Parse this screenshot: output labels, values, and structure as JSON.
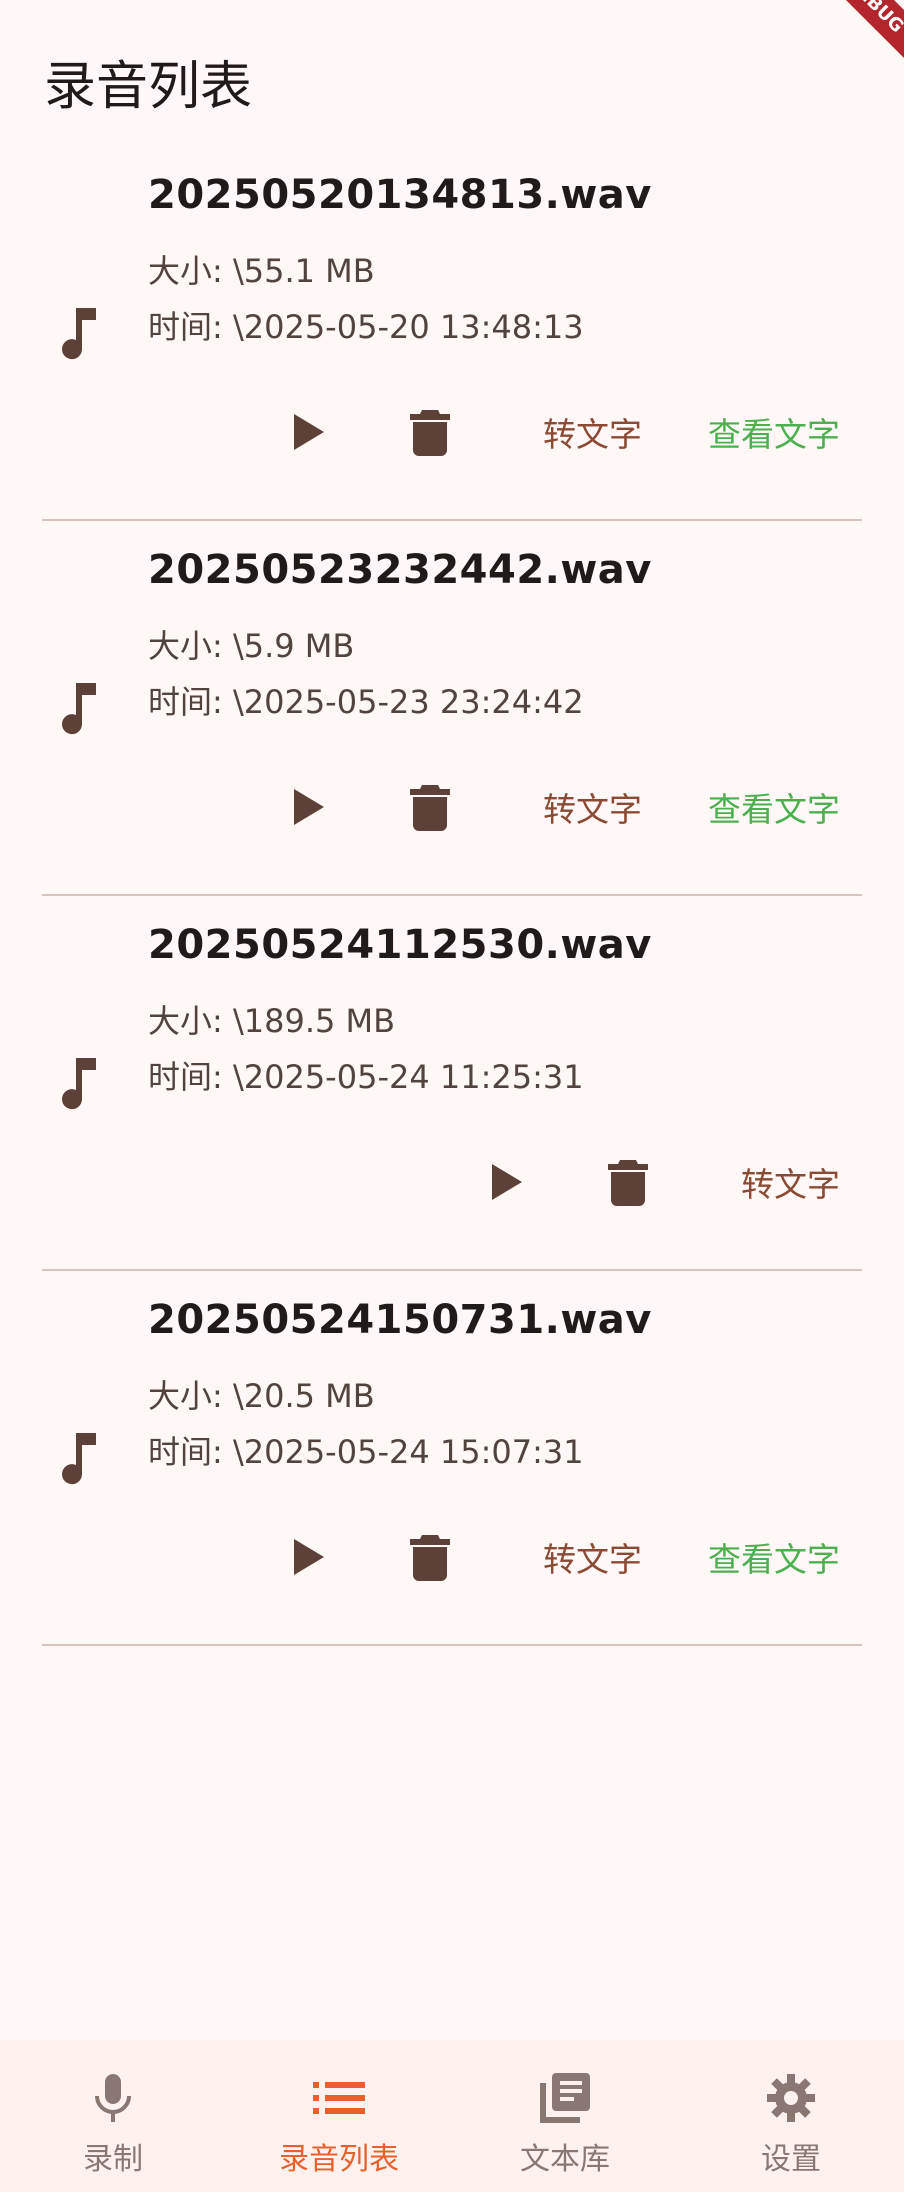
{
  "debug_banner": "DEBUG",
  "app_bar": {
    "title": "录音列表"
  },
  "recordings": [
    {
      "name": "20250520134813.wav",
      "size": "大小: \\55.1 MB",
      "time": "时间: \\2025-05-20 13:48:13",
      "has_text": true
    },
    {
      "name": "20250523232442.wav",
      "size": "大小: \\5.9 MB",
      "time": "时间: \\2025-05-23 23:24:42",
      "has_text": true
    },
    {
      "name": "20250524112530.wav",
      "size": "大小: \\189.5 MB",
      "time": "时间: \\2025-05-24 11:25:31",
      "has_text": false
    },
    {
      "name": "20250524150731.wav",
      "size": "大小: \\20.5 MB",
      "time": "时间: \\2025-05-24 15:07:31",
      "has_text": true
    }
  ],
  "actions": {
    "play_icon": "play-icon",
    "delete_icon": "trash-icon",
    "transcribe_label": "转文字",
    "view_text_label": "查看文字"
  },
  "bottom_nav": {
    "items": [
      {
        "label": "录制",
        "icon": "mic-icon",
        "active": false
      },
      {
        "label": "录音列表",
        "icon": "list-icon",
        "active": true
      },
      {
        "label": "文本库",
        "icon": "library-icon",
        "active": false
      },
      {
        "label": "设置",
        "icon": "gear-icon",
        "active": false
      }
    ]
  },
  "colors": {
    "background": "#FFF8F6",
    "icon": "#5D4037",
    "transcribe": "#8B4A33",
    "view_text": "#4CAF50",
    "nav_active": "#E8602B",
    "nav_inactive": "#8A7772",
    "divider": "#D8C2BC"
  }
}
